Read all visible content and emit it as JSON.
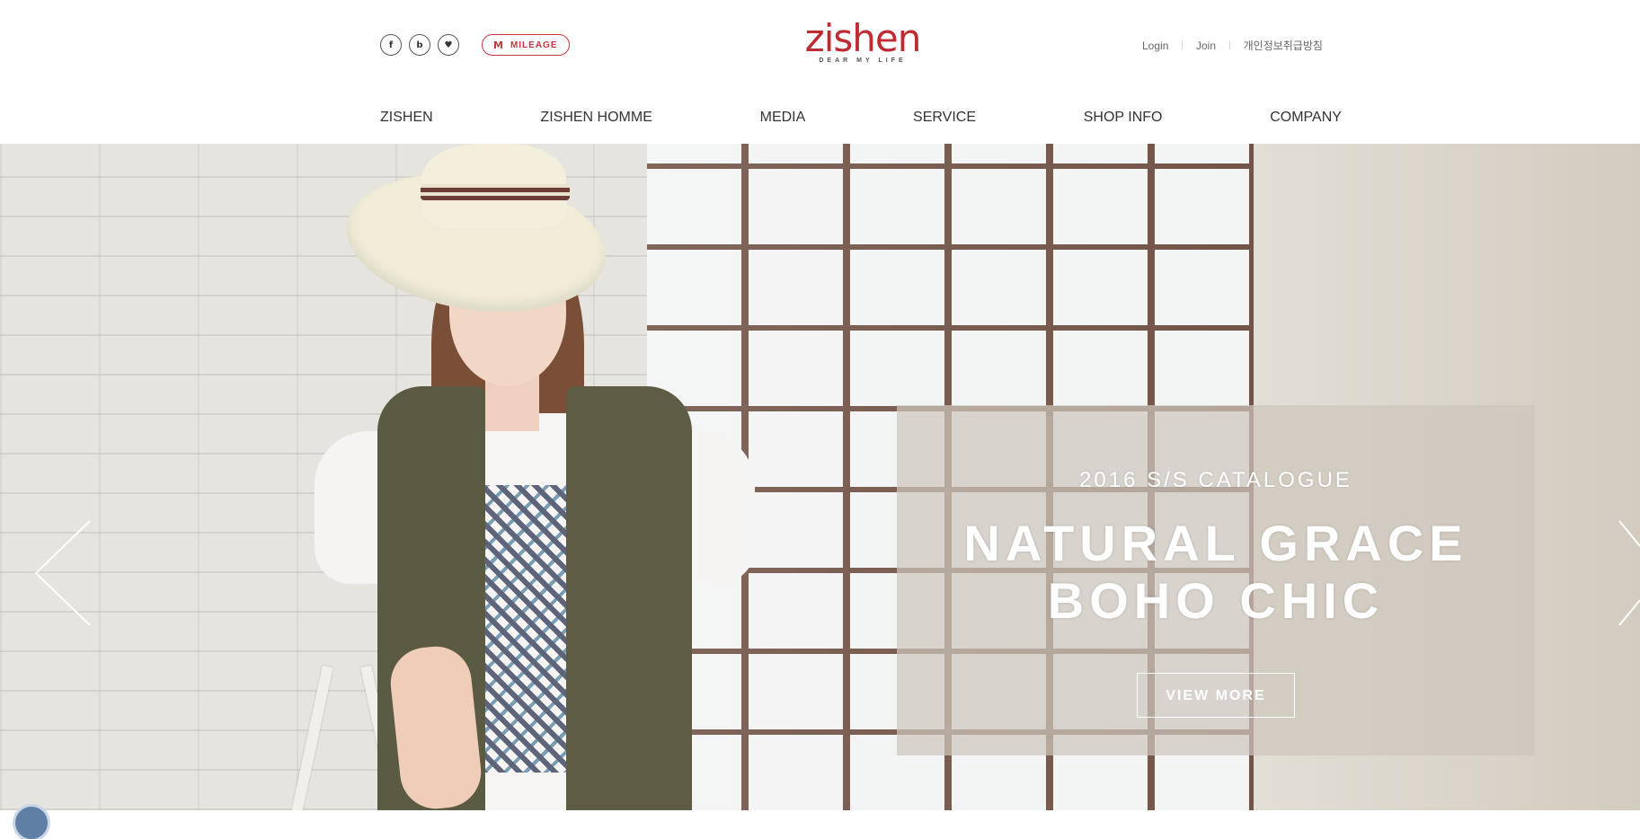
{
  "header": {
    "social": [
      {
        "label": "f",
        "icon": "facebook-icon"
      },
      {
        "label": "b",
        "icon": "blog-icon"
      },
      {
        "label": "♥",
        "icon": "pin-icon"
      }
    ],
    "mileage": {
      "icon_label": "M",
      "label": "MILEAGE"
    },
    "logo": {
      "word": "zishen",
      "tagline": "DEAR MY LIFE"
    },
    "util_links": [
      "Login",
      "Join",
      "개인정보취급방침"
    ],
    "nav": [
      "ZISHEN",
      "ZISHEN HOMME",
      "MEDIA",
      "SERVICE",
      "SHOP INFO",
      "COMPANY"
    ]
  },
  "hero": {
    "kicker": "2016 S/S CATALOGUE",
    "title_line1": "NATURAL GRACE",
    "title_line2": "BOHO CHIC",
    "button": "VIEW MORE"
  },
  "colors": {
    "brand": "#c02a33",
    "text": "#333333"
  }
}
